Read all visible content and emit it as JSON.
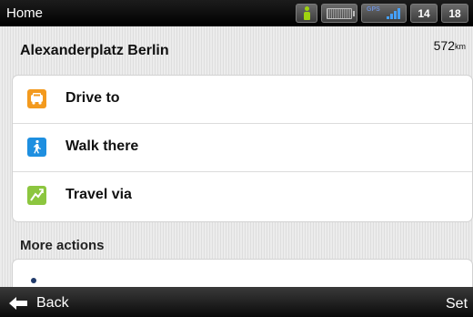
{
  "header": {
    "title": "Home",
    "status": {
      "person_icon": "walking-person-icon",
      "battery_icon": "battery-icon",
      "gps_label": "GPS",
      "signal_icon": "gps-signal-icon",
      "time_hour": "14",
      "time_minute": "18"
    }
  },
  "location": {
    "name": "Alexanderplatz Berlin",
    "distance": "572",
    "distance_unit": "km"
  },
  "actions": [
    {
      "label": "Drive to",
      "icon": "car-icon",
      "color": "#f39a1e"
    },
    {
      "label": "Walk there",
      "icon": "walking-icon",
      "color": "#1e8fe0"
    },
    {
      "label": "Travel via",
      "icon": "route-icon",
      "color": "#8cc63f"
    }
  ],
  "more_actions": {
    "heading": "More actions"
  },
  "footer": {
    "back_label": "Back",
    "back_icon": "arrow-left-icon",
    "right_label": "Set"
  },
  "colors": {
    "top_bar": "#000000",
    "bottom_bar": "#1a1a1a",
    "background": "#e6e6e6",
    "signal": "#44a0ff",
    "person": "#9ed20f"
  }
}
